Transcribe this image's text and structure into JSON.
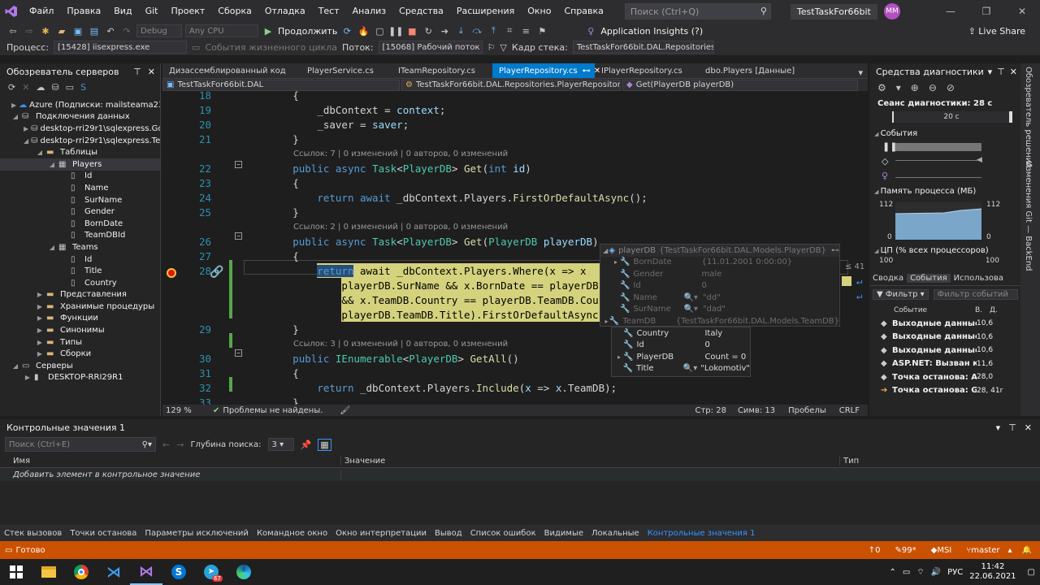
{
  "menubar": {
    "items": [
      "Файл",
      "Правка",
      "Вид",
      "Git",
      "Проект",
      "Сборка",
      "Отладка",
      "Тест",
      "Анализ",
      "Средства",
      "Расширения",
      "Окно",
      "Справка"
    ],
    "search_placeholder": "Поиск (Ctrl+Q)",
    "project_title": "TestTaskFor66bit",
    "avatar": "MM"
  },
  "toolbar": {
    "config": "Debug",
    "platform": "Any CPU",
    "continue_label": "Продолжить",
    "app_insights": "Application Insights (?)",
    "live_share": "Live Share"
  },
  "toolbar2": {
    "process_label": "Процесс:",
    "process_value": "[15428] iisexpress.exe",
    "lifecycle": "События жизненного цикла",
    "thread_label": "Поток:",
    "thread_value": "[15068] Рабочий поток",
    "frame_label": "Кадр стека:",
    "frame_value": "TestTaskFor66bit.DAL.Repositories.PlayerR"
  },
  "server_explorer": {
    "title": "Обозреватель серверов",
    "tree": [
      {
        "depth": 0,
        "arrow": "▶",
        "icon": "azure",
        "label": "Azure (Подписки: mailsteama230"
      },
      {
        "depth": 0,
        "arrow": "◢",
        "icon": "db",
        "label": "Подключения данных"
      },
      {
        "depth": 1,
        "arrow": "▶",
        "icon": "db",
        "label": "desktop-rri29r1\\sqlexpress.Go"
      },
      {
        "depth": 1,
        "arrow": "◢",
        "icon": "db",
        "label": "desktop-rri29r1\\sqlexpress.Tes"
      },
      {
        "depth": 2,
        "arrow": "◢",
        "icon": "folder",
        "label": "Таблицы"
      },
      {
        "depth": 3,
        "arrow": "◢",
        "icon": "table",
        "label": "Players",
        "selected": true
      },
      {
        "depth": 4,
        "arrow": "",
        "icon": "col",
        "label": "Id"
      },
      {
        "depth": 4,
        "arrow": "",
        "icon": "col",
        "label": "Name"
      },
      {
        "depth": 4,
        "arrow": "",
        "icon": "col",
        "label": "SurName"
      },
      {
        "depth": 4,
        "arrow": "",
        "icon": "col",
        "label": "Gender"
      },
      {
        "depth": 4,
        "arrow": "",
        "icon": "col",
        "label": "BornDate"
      },
      {
        "depth": 4,
        "arrow": "",
        "icon": "col",
        "label": "TeamDBId"
      },
      {
        "depth": 3,
        "arrow": "◢",
        "icon": "table",
        "label": "Teams"
      },
      {
        "depth": 4,
        "arrow": "",
        "icon": "col",
        "label": "Id"
      },
      {
        "depth": 4,
        "arrow": "",
        "icon": "col",
        "label": "Title"
      },
      {
        "depth": 4,
        "arrow": "",
        "icon": "col",
        "label": "Country"
      },
      {
        "depth": 2,
        "arrow": "▶",
        "icon": "folder",
        "label": "Представления"
      },
      {
        "depth": 2,
        "arrow": "▶",
        "icon": "folder",
        "label": "Хранимые процедуры"
      },
      {
        "depth": 2,
        "arrow": "▶",
        "icon": "folder",
        "label": "Функции"
      },
      {
        "depth": 2,
        "arrow": "▶",
        "icon": "folder",
        "label": "Синонимы"
      },
      {
        "depth": 2,
        "arrow": "▶",
        "icon": "folder",
        "label": "Типы"
      },
      {
        "depth": 2,
        "arrow": "▶",
        "icon": "folder",
        "label": "Сборки"
      },
      {
        "depth": 0,
        "arrow": "◢",
        "icon": "server",
        "label": "Серверы"
      },
      {
        "depth": 1,
        "arrow": "▶",
        "icon": "pc",
        "label": "DESKTOP-RRI29R1"
      }
    ]
  },
  "editor": {
    "tabs": [
      {
        "label": "Дизассемблированный код",
        "active": false
      },
      {
        "label": "PlayerService.cs",
        "active": false
      },
      {
        "label": "ITeamRepository.cs",
        "active": false
      },
      {
        "label": "PlayerRepository.cs",
        "active": true
      },
      {
        "label": "IPlayerRepository.cs",
        "active": false
      },
      {
        "label": "dbo.Players [Данные]",
        "active": false
      }
    ],
    "nav_project": "TestTaskFor66bit.DAL",
    "nav_class": "TestTaskFor66bit.DAL.Repositories.PlayerRepository",
    "nav_member": "Get(PlayerDB playerDB)",
    "zoom": "129 %",
    "problems": "Проблемы не найдены.",
    "line": "Стр: 28",
    "col": "Симв: 13",
    "whitespace": "Пробелы",
    "eol": "CRLF"
  },
  "code_lines": [
    {
      "n": "18",
      "t": "        {"
    },
    {
      "n": "19",
      "t": "            _dbContext = context;"
    },
    {
      "n": "20",
      "t": "            _saver = saver;"
    },
    {
      "n": "21",
      "t": "        }"
    },
    {
      "lens": "Ссылок: 7 | 0 изменений | 0 авторов, 0 изменений"
    },
    {
      "n": "22",
      "t": "        public async Task<PlayerDB> Get(int id)"
    },
    {
      "n": "23",
      "t": "        {"
    },
    {
      "n": "24",
      "t": "            return await _dbContext.Players.FirstOrDefaultAsync();"
    },
    {
      "n": "25",
      "t": "        }"
    },
    {
      "lens": "Ссылок: 2 | 0 изменений | 0 авторов, 0 изменений"
    },
    {
      "n": "26",
      "t": "        public async Task<PlayerDB> Get(PlayerDB playerDB)"
    },
    {
      "n": "27",
      "t": "        {"
    },
    {
      "n": "28",
      "t": "            return await _dbContext.Players.Where(x => x",
      "current": true
    },
    {
      "t": "                playerDB.SurName && x.BornDate == playerDB.",
      "current": true
    },
    {
      "t": "                && x.TeamDB.Country == playerDB.TeamDB.Cou",
      "current": true
    },
    {
      "t": "                playerDB.TeamDB.Title).FirstOrDefaultAsync(",
      "current": true
    },
    {
      "n": "29",
      "t": "        }"
    },
    {
      "lens": "Ссылок: 3 | 0 изменений | 0 авторов, 0 изменений"
    },
    {
      "n": "30",
      "t": "        public IEnumerable<PlayerDB> GetAll()"
    },
    {
      "n": "31",
      "t": "        {"
    },
    {
      "n": "32",
      "t": "            return _dbContext.Players.Include(x => x.TeamDB);"
    },
    {
      "n": "33",
      "t": "        }"
    }
  ],
  "datatip": {
    "root_name": "playerDB",
    "root_type": "{TestTaskFor66bit.DAL.Models.PlayerDB}",
    "rows": [
      {
        "name": "BornDate",
        "value": "{11.01.2001 0:00:00}"
      },
      {
        "name": "Gender",
        "value": "male"
      },
      {
        "name": "Id",
        "value": "0"
      },
      {
        "name": "Name",
        "value": "\"dd\""
      },
      {
        "name": "SurName",
        "value": "\"dad\""
      },
      {
        "name": "TeamDB",
        "value": "{TestTaskFor66bit.DAL.Models.TeamDB}"
      }
    ],
    "team_rows": [
      {
        "name": "Country",
        "value": "Italy"
      },
      {
        "name": "Id",
        "value": "0"
      },
      {
        "name": "PlayerDB",
        "value": "Count = 0"
      },
      {
        "name": "Title",
        "value": "\"Lokomotiv\""
      }
    ],
    "side_label": "≤ 41"
  },
  "diagnostics": {
    "title": "Средства диагностики",
    "session": "Сеанс диагностики: 28 с",
    "ruler": "20 с",
    "events": "События",
    "memory": "Память процесса (МБ)",
    "mem_max_left": "112",
    "mem_max_right": "112",
    "mem_min_left": "0",
    "mem_min_right": "0",
    "cpu": "ЦП (% всех процессоров)",
    "cpu_left": "100",
    "cpu_right": "100",
    "tabs": [
      "Сводка",
      "События",
      "Использова"
    ],
    "filter": "Фильтр",
    "filter_events": "Фильтр событий",
    "col_event": "Событие",
    "col_b": "В.",
    "col_d": "Д.",
    "events_list": [
      {
        "label": "Выходные данные...",
        "v": "10,6"
      },
      {
        "label": "Выходные данные...",
        "v": "10,6"
      },
      {
        "label": "Выходные данные...",
        "v": "10,6"
      },
      {
        "label": "ASP.NET: Вызван к...",
        "v": "11,6"
      },
      {
        "label": "Точка останова: А...",
        "v": "28,0"
      },
      {
        "label": "Точка останова: G...",
        "v": "28, 41r"
      }
    ]
  },
  "right_vertical_tabs": [
    "Обозреватель решений",
    "Изменения Git — BackEnd"
  ],
  "watch": {
    "title": "Контрольные значения 1",
    "search_placeholder": "Поиск (Ctrl+E)",
    "depth_label": "Глубина поиска:",
    "depth_value": "3",
    "col_name": "Имя",
    "col_value": "Значение",
    "col_type": "Тип",
    "add_hint": "Добавить элемент в контрольное значение"
  },
  "bottom_tabs": [
    "Стек вызовов",
    "Точки останова",
    "Параметры исключений",
    "Командное окно",
    "Окно интерпретации",
    "Вывод",
    "Список ошибок",
    "Видимые",
    "Локальные",
    "Контрольные значения 1"
  ],
  "statusbar": {
    "ready": "Готово",
    "up": "0",
    "edits": "99*",
    "branch_user": "MSI",
    "branch": "master"
  },
  "taskbar": {
    "lang": "РУС",
    "time": "11:42",
    "date": "22.06.2021",
    "badge": "67"
  },
  "colors": {
    "accent": "#007acc",
    "status": "#ca5100",
    "highlight": "#d4d27d"
  }
}
